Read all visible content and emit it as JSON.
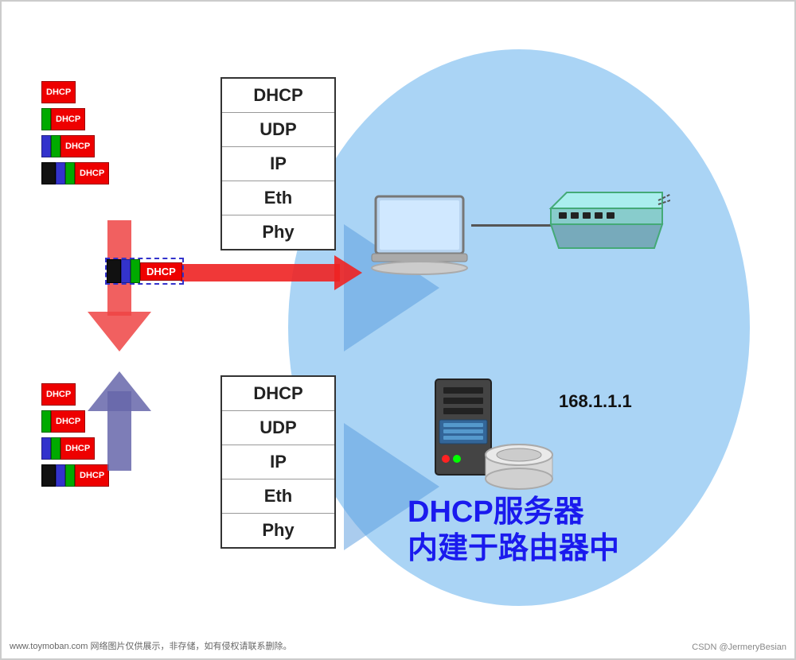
{
  "bg": {
    "blob_color": "#aad4f5"
  },
  "top_stack": {
    "layers": [
      "DHCP",
      "UDP",
      "IP",
      "Eth",
      "Phy"
    ]
  },
  "bottom_stack": {
    "layers": [
      "DHCP",
      "UDP",
      "IP",
      "Eth",
      "Phy"
    ]
  },
  "top_packets": [
    {
      "segments": [
        "dhcp"
      ]
    },
    {
      "segments": [
        "udp",
        "dhcp"
      ]
    },
    {
      "segments": [
        "ip",
        "udp",
        "dhcp"
      ]
    },
    {
      "segments": [
        "eth",
        "ip",
        "udp",
        "dhcp"
      ]
    }
  ],
  "bottom_packets": [
    {
      "segments": [
        "dhcp"
      ]
    },
    {
      "segments": [
        "udp",
        "dhcp"
      ]
    },
    {
      "segments": [
        "ip",
        "udp",
        "dhcp"
      ]
    },
    {
      "segments": [
        "eth",
        "ip",
        "udp",
        "dhcp"
      ]
    }
  ],
  "sending_packet": {
    "segments": [
      "eth",
      "ip",
      "udp",
      "dhcp"
    ]
  },
  "ip_label": "168.1.1.1",
  "server_label_line1": "DHCP服务器",
  "server_label_line2": "内建于路由器中",
  "watermark_left": "www.toymoban.com 网络图片仅供展示，非存储，如有侵权请联系删除。",
  "watermark_right": "CSDN @JermeryBesian",
  "segments": {
    "dhcp": {
      "label": "DHCP",
      "color": "#dd0000",
      "border": "#990000"
    },
    "udp": {
      "label": "",
      "color": "#009900",
      "border": "#006600"
    },
    "ip": {
      "label": "",
      "color": "#3333cc",
      "border": "#222288"
    },
    "eth": {
      "label": "",
      "color": "#111111",
      "border": "#000000"
    }
  }
}
